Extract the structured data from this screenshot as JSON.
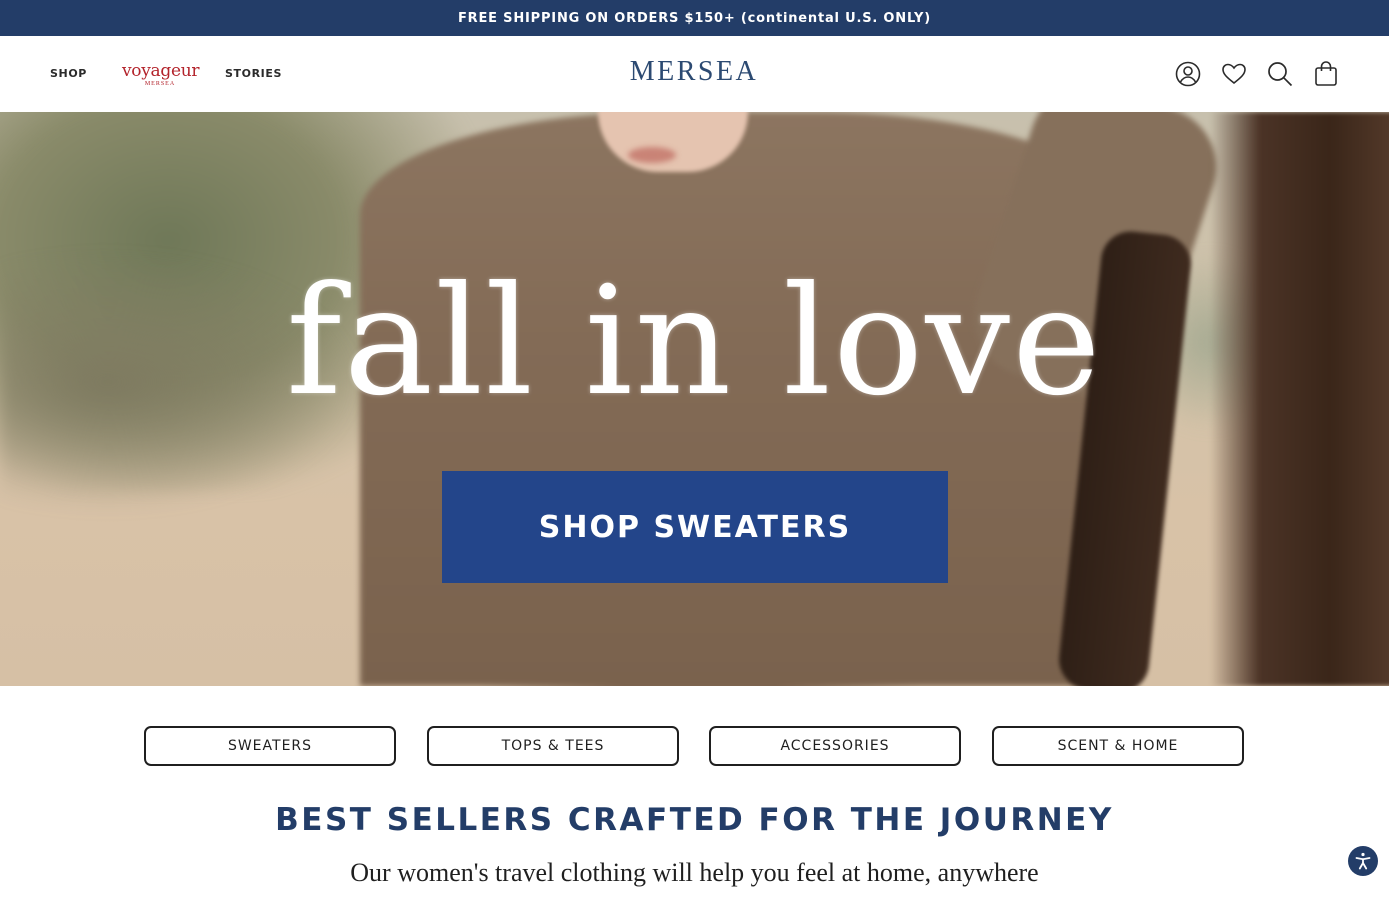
{
  "announcement": {
    "text": "FREE SHIPPING ON ORDERS $150+ (continental U.S. ONLY)"
  },
  "header": {
    "nav": {
      "shop": "SHOP",
      "stories": "STORIES"
    },
    "voyageur": {
      "main": "voyageur",
      "sub": "MERSEA"
    },
    "logo": "MERSEA",
    "icons": [
      "account-icon",
      "heart-icon",
      "search-icon",
      "bag-icon"
    ]
  },
  "hero": {
    "headline": "fall in love",
    "cta": "SHOP SWEATERS"
  },
  "categories": [
    "SWEATERS",
    "TOPS & TEES",
    "ACCESSORIES",
    "SCENT & HOME"
  ],
  "bestsellers": {
    "title": "BEST SELLERS CRAFTED FOR THE JOURNEY",
    "subtitle": "Our women's travel clothing will help you feel at home, anywhere"
  },
  "colors": {
    "brand_navy": "#233d68",
    "cta_blue": "#23458a",
    "voyageur_red": "#b3232b"
  }
}
